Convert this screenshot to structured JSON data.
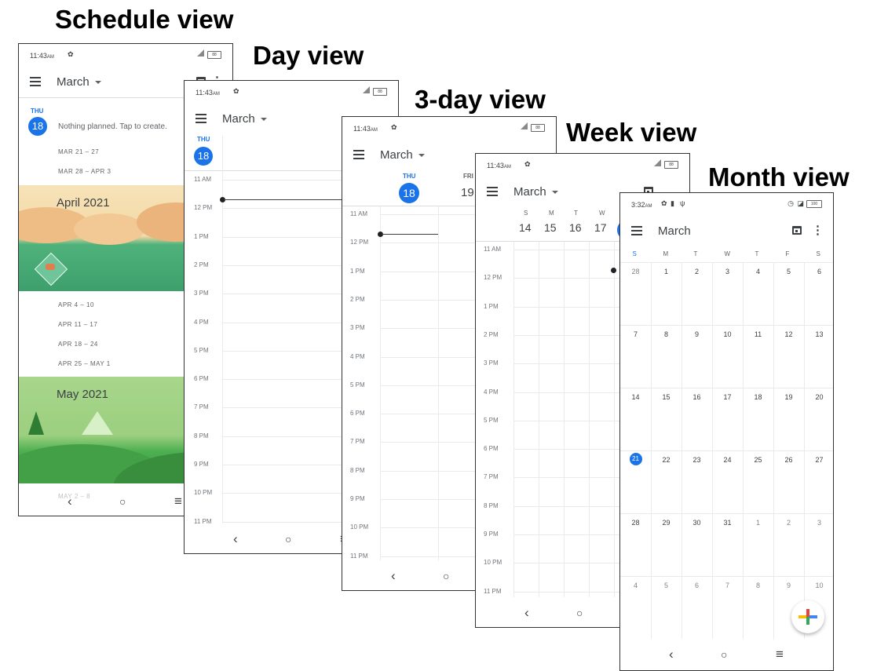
{
  "captions": {
    "schedule": "Schedule view",
    "day": "Day view",
    "three_day": "3-day view",
    "week": "Week view",
    "month": "Month view"
  },
  "status_time": "11:43",
  "status_ampm": "AM",
  "battery_text": "88",
  "month_status_time": "3:32",
  "month_status_ampm": "AM",
  "month_battery_text": "100",
  "month_title": "March",
  "schedule": {
    "day_name": "THU",
    "day_num": "18",
    "empty_text": "Nothing planned. Tap to create.",
    "weeks_before": [
      "MAR 21 – 27",
      "MAR 28 – APR 3"
    ],
    "april_label": "April 2021",
    "weeks_april": [
      "APR 4 – 10",
      "APR 11 – 17",
      "APR 18 – 24",
      "APR 25 – MAY 1"
    ],
    "may_label": "May 2021",
    "peek_text": "MAY 2 – 8"
  },
  "day": {
    "day_name": "THU",
    "day_num": "18",
    "hours": [
      "11 AM",
      "12 PM",
      "1 PM",
      "2 PM",
      "3 PM",
      "4 PM",
      "5 PM",
      "6 PM",
      "7 PM",
      "8 PM",
      "9 PM",
      "10 PM",
      "11 PM"
    ]
  },
  "three_day": {
    "days": [
      {
        "name": "THU",
        "num": "18"
      },
      {
        "name": "FRI",
        "num": "19"
      }
    ],
    "hours": [
      "11 AM",
      "12 PM",
      "1 PM",
      "2 PM",
      "3 PM",
      "4 PM",
      "5 PM",
      "6 PM",
      "7 PM",
      "8 PM",
      "9 PM",
      "10 PM",
      "11 PM"
    ]
  },
  "week": {
    "day_letters": [
      "S",
      "M",
      "T",
      "W"
    ],
    "day_nums": [
      "14",
      "15",
      "16",
      "17"
    ],
    "hours": [
      "11 AM",
      "12 PM",
      "1 PM",
      "2 PM",
      "3 PM",
      "4 PM",
      "5 PM",
      "6 PM",
      "7 PM",
      "8 PM",
      "9 PM",
      "10 PM",
      "11 PM"
    ]
  },
  "month": {
    "weekdays": [
      "S",
      "M",
      "T",
      "W",
      "T",
      "F",
      "S"
    ],
    "rows": [
      [
        "28",
        "1",
        "2",
        "3",
        "4",
        "5",
        "6"
      ],
      [
        "7",
        "8",
        "9",
        "10",
        "11",
        "12",
        "13"
      ],
      [
        "14",
        "15",
        "16",
        "17",
        "18",
        "19",
        "20"
      ],
      [
        "21",
        "22",
        "23",
        "24",
        "25",
        "26",
        "27"
      ],
      [
        "28",
        "29",
        "30",
        "31",
        "1",
        "2",
        "3"
      ],
      [
        "4",
        "5",
        "6",
        "7",
        "8",
        "9",
        "10"
      ]
    ],
    "today": "21"
  },
  "colors": {
    "accent_blue": "#1a73e8",
    "text": "#3c4043",
    "muted": "#70757a",
    "grid": "#e8eaed"
  },
  "icons": {
    "menu": "hamburger-menu-icon",
    "calendar": "calendar-today-icon",
    "more": "more-vert-icon",
    "back": "back-nav-icon",
    "home": "home-nav-icon",
    "recents": "recents-nav-icon",
    "fab": "google-plus-icon"
  }
}
